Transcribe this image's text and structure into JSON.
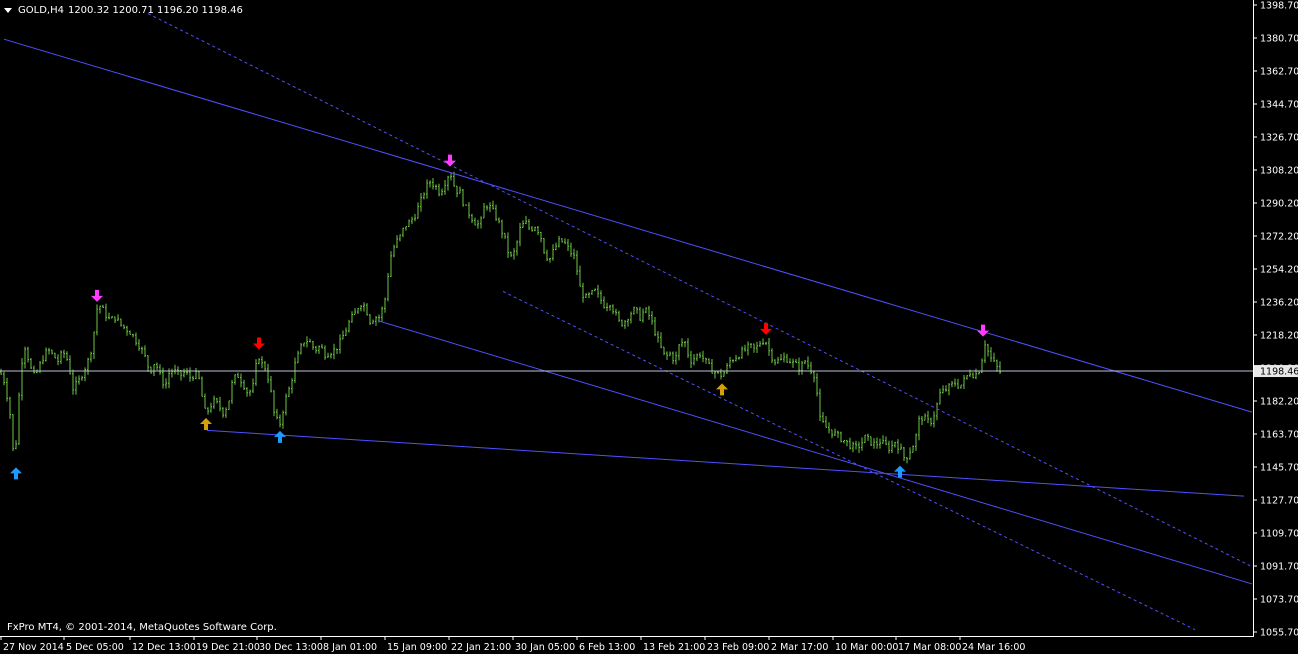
{
  "header": {
    "symbol": "GOLD,H4",
    "ohlc": "1200.32 1200.71 1196.20 1198.46"
  },
  "footer": {
    "copyright_prefix": "FxPro MT4, ",
    "copyright_symbol": "©",
    "copyright_rest": " 2001-2014, MetaQuotes Software Corp."
  },
  "colors": {
    "background": "#000000",
    "bars": "#6cc644",
    "axes": "#ffffff",
    "trendline": "#5050ff",
    "price_line": "#c0c0d8",
    "current_price_bg": "#e8e8e8",
    "arrow_magenta": "#ff3cff",
    "arrow_red": "#ff0000",
    "arrow_cyan": "#1e9bff",
    "arrow_gold": "#d4a10a"
  },
  "chart_data": {
    "type": "ohlc",
    "symbol": "GOLD",
    "timeframe": "H4",
    "current_price": 1198.46,
    "current_price_label": "1198.46",
    "ylim": [
      1055.7,
      1398.7
    ],
    "y_ticks": [
      "1398.70",
      "1380.70",
      "1362.70",
      "1344.70",
      "1326.70",
      "1308.20",
      "1290.20",
      "1272.20",
      "1254.20",
      "1236.20",
      "1218.20",
      "1200.20",
      "1182.20",
      "1163.70",
      "1145.70",
      "1127.70",
      "1109.70",
      "1091.70",
      "1073.70",
      "1055.70"
    ],
    "x_ticks": [
      "27 Nov 2014",
      "5 Dec 05:00",
      "12 Dec 13:00",
      "19 Dec 21:00",
      "30 Dec 13:00",
      "8 Jan 01:00",
      "15 Jan 09:00",
      "22 Jan 21:00",
      "30 Jan 05:00",
      "6 Feb 13:00",
      "13 Feb 21:00",
      "23 Feb 09:00",
      "2 Mar 17:00",
      "10 Mar 00:00",
      "17 Mar 08:00",
      "24 Mar 16:00"
    ],
    "close_path": [
      [
        0,
        1198
      ],
      [
        5,
        1192
      ],
      [
        10,
        1175
      ],
      [
        14,
        1149
      ],
      [
        17,
        1165
      ],
      [
        20,
        1195
      ],
      [
        24,
        1214
      ],
      [
        28,
        1206
      ],
      [
        33,
        1195
      ],
      [
        38,
        1199
      ],
      [
        43,
        1206
      ],
      [
        48,
        1210
      ],
      [
        53,
        1207
      ],
      [
        58,
        1204
      ],
      [
        63,
        1209
      ],
      [
        68,
        1204
      ],
      [
        73,
        1189
      ],
      [
        78,
        1192
      ],
      [
        83,
        1198
      ],
      [
        88,
        1204
      ],
      [
        93,
        1214
      ],
      [
        96,
        1232
      ],
      [
        100,
        1234
      ],
      [
        105,
        1230
      ],
      [
        110,
        1226
      ],
      [
        115,
        1228
      ],
      [
        120,
        1224
      ],
      [
        125,
        1222
      ],
      [
        130,
        1220
      ],
      [
        135,
        1216
      ],
      [
        140,
        1212
      ],
      [
        145,
        1206
      ],
      [
        150,
        1198
      ],
      [
        155,
        1204
      ],
      [
        160,
        1196
      ],
      [
        165,
        1190
      ],
      [
        170,
        1199
      ],
      [
        175,
        1198
      ],
      [
        180,
        1196
      ],
      [
        185,
        1198
      ],
      [
        190,
        1195
      ],
      [
        195,
        1197
      ],
      [
        200,
        1193
      ],
      [
        204,
        1176
      ],
      [
        208,
        1177
      ],
      [
        213,
        1182
      ],
      [
        218,
        1180
      ],
      [
        223,
        1176
      ],
      [
        228,
        1180
      ],
      [
        233,
        1194
      ],
      [
        238,
        1196
      ],
      [
        243,
        1192
      ],
      [
        248,
        1186
      ],
      [
        253,
        1190
      ],
      [
        258,
        1208
      ],
      [
        262,
        1202
      ],
      [
        266,
        1200
      ],
      [
        270,
        1190
      ],
      [
        275,
        1172
      ],
      [
        280,
        1170
      ],
      [
        285,
        1182
      ],
      [
        290,
        1190
      ],
      [
        295,
        1202
      ],
      [
        300,
        1210
      ],
      [
        305,
        1216
      ],
      [
        310,
        1214
      ],
      [
        315,
        1210
      ],
      [
        320,
        1212
      ],
      [
        325,
        1208
      ],
      [
        330,
        1209
      ],
      [
        335,
        1210
      ],
      [
        340,
        1214
      ],
      [
        345,
        1220
      ],
      [
        350,
        1226
      ],
      [
        355,
        1230
      ],
      [
        360,
        1236
      ],
      [
        365,
        1234
      ],
      [
        370,
        1226
      ],
      [
        375,
        1228
      ],
      [
        380,
        1228
      ],
      [
        385,
        1238
      ],
      [
        390,
        1260
      ],
      [
        395,
        1268
      ],
      [
        400,
        1272
      ],
      [
        405,
        1278
      ],
      [
        410,
        1280
      ],
      [
        415,
        1284
      ],
      [
        420,
        1290
      ],
      [
        425,
        1298
      ],
      [
        430,
        1302
      ],
      [
        435,
        1300
      ],
      [
        440,
        1296
      ],
      [
        445,
        1302
      ],
      [
        450,
        1308
      ],
      [
        455,
        1298
      ],
      [
        460,
        1296
      ],
      [
        465,
        1288
      ],
      [
        470,
        1284
      ],
      [
        475,
        1280
      ],
      [
        480,
        1278
      ],
      [
        485,
        1290
      ],
      [
        490,
        1288
      ],
      [
        495,
        1284
      ],
      [
        500,
        1278
      ],
      [
        505,
        1270
      ],
      [
        510,
        1260
      ],
      [
        515,
        1264
      ],
      [
        520,
        1276
      ],
      [
        525,
        1280
      ],
      [
        530,
        1276
      ],
      [
        535,
        1278
      ],
      [
        540,
        1274
      ],
      [
        545,
        1262
      ],
      [
        550,
        1260
      ],
      [
        555,
        1266
      ],
      [
        560,
        1270
      ],
      [
        565,
        1268
      ],
      [
        570,
        1264
      ],
      [
        575,
        1260
      ],
      [
        580,
        1244
      ],
      [
        585,
        1238
      ],
      [
        590,
        1240
      ],
      [
        595,
        1242
      ],
      [
        600,
        1238
      ],
      [
        605,
        1234
      ],
      [
        610,
        1236
      ],
      [
        615,
        1230
      ],
      [
        620,
        1224
      ],
      [
        625,
        1226
      ],
      [
        630,
        1230
      ],
      [
        635,
        1232
      ],
      [
        640,
        1228
      ],
      [
        645,
        1232
      ],
      [
        650,
        1228
      ],
      [
        655,
        1220
      ],
      [
        660,
        1212
      ],
      [
        665,
        1206
      ],
      [
        670,
        1208
      ],
      [
        675,
        1204
      ],
      [
        680,
        1214
      ],
      [
        685,
        1214
      ],
      [
        690,
        1204
      ],
      [
        695,
        1206
      ],
      [
        700,
        1208
      ],
      [
        705,
        1204
      ],
      [
        710,
        1200
      ],
      [
        715,
        1198
      ],
      [
        720,
        1196
      ],
      [
        725,
        1198
      ],
      [
        730,
        1204
      ],
      [
        735,
        1206
      ],
      [
        740,
        1208
      ],
      [
        745,
        1210
      ],
      [
        750,
        1212
      ],
      [
        755,
        1210
      ],
      [
        760,
        1214
      ],
      [
        765,
        1216
      ],
      [
        770,
        1208
      ],
      [
        775,
        1204
      ],
      [
        780,
        1204
      ],
      [
        785,
        1206
      ],
      [
        790,
        1204
      ],
      [
        795,
        1202
      ],
      [
        800,
        1200
      ],
      [
        805,
        1204
      ],
      [
        810,
        1200
      ],
      [
        815,
        1196
      ],
      [
        820,
        1172
      ],
      [
        825,
        1168
      ],
      [
        830,
        1166
      ],
      [
        835,
        1164
      ],
      [
        840,
        1162
      ],
      [
        845,
        1160
      ],
      [
        850,
        1158
      ],
      [
        855,
        1156
      ],
      [
        860,
        1158
      ],
      [
        865,
        1162
      ],
      [
        870,
        1160
      ],
      [
        875,
        1158
      ],
      [
        880,
        1160
      ],
      [
        885,
        1158
      ],
      [
        890,
        1156
      ],
      [
        895,
        1160
      ],
      [
        900,
        1156
      ],
      [
        905,
        1150
      ],
      [
        910,
        1155
      ],
      [
        915,
        1160
      ],
      [
        920,
        1174
      ],
      [
        925,
        1172
      ],
      [
        930,
        1170
      ],
      [
        935,
        1176
      ],
      [
        940,
        1186
      ],
      [
        945,
        1188
      ],
      [
        950,
        1190
      ],
      [
        955,
        1192
      ],
      [
        960,
        1190
      ],
      [
        965,
        1194
      ],
      [
        970,
        1198
      ],
      [
        975,
        1196
      ],
      [
        980,
        1200
      ],
      [
        985,
        1214
      ],
      [
        990,
        1206
      ],
      [
        995,
        1202
      ],
      [
        1000,
        1198
      ]
    ],
    "trendlines": [
      {
        "style": "solid",
        "p1": [
          4,
          1380
        ],
        "p2": [
          1252,
          1176
        ]
      },
      {
        "style": "solid",
        "p1": [
          378,
          1226
        ],
        "p2": [
          1252,
          1082
        ]
      },
      {
        "style": "solid",
        "p1": [
          207,
          1166
        ],
        "p2": [
          1244,
          1130
        ]
      },
      {
        "style": "dashed",
        "p1": [
          148,
          1394
        ],
        "p2": [
          1250,
          1092
        ]
      },
      {
        "style": "dashed",
        "p1": [
          503,
          1242
        ],
        "p2": [
          1195,
          1057
        ]
      }
    ],
    "signals": [
      {
        "type": "up",
        "color": "cyan",
        "x": 16,
        "price": 1143
      },
      {
        "type": "down",
        "color": "magenta",
        "x": 97,
        "price": 1239
      },
      {
        "type": "up",
        "color": "gold",
        "x": 206,
        "price": 1170
      },
      {
        "type": "down",
        "color": "red",
        "x": 259,
        "price": 1213
      },
      {
        "type": "up",
        "color": "cyan",
        "x": 280,
        "price": 1163
      },
      {
        "type": "down",
        "color": "magenta",
        "x": 450,
        "price": 1313
      },
      {
        "type": "up",
        "color": "gold",
        "x": 722,
        "price": 1189
      },
      {
        "type": "down",
        "color": "red",
        "x": 766,
        "price": 1221
      },
      {
        "type": "up",
        "color": "cyan",
        "x": 900,
        "price": 1144
      },
      {
        "type": "down",
        "color": "magenta",
        "x": 983,
        "price": 1220
      }
    ]
  }
}
